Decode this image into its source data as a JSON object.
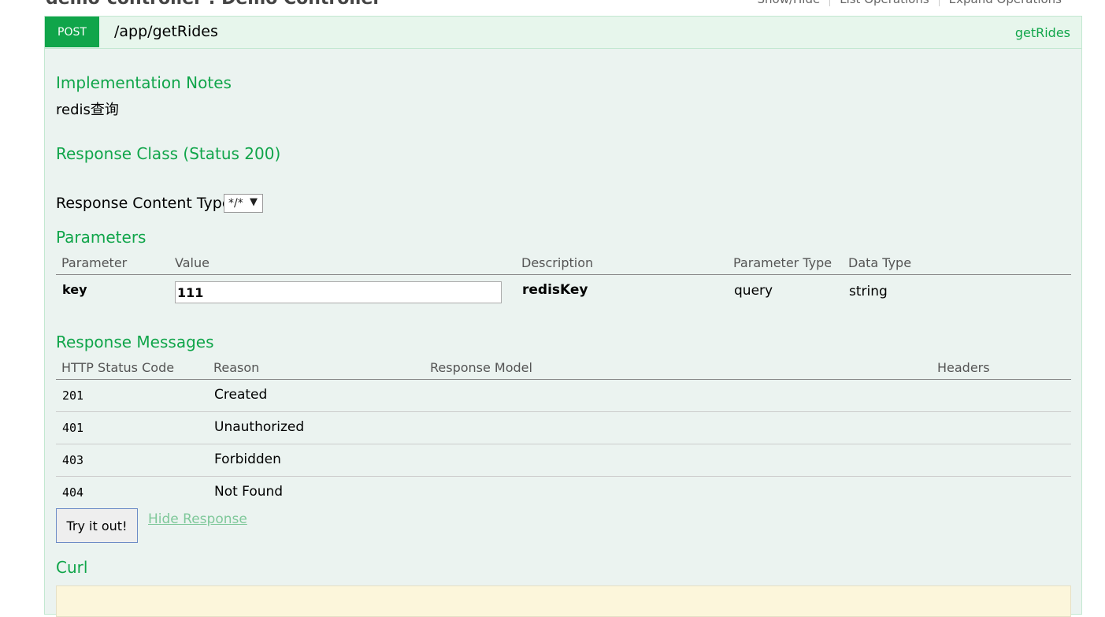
{
  "controller": {
    "title": "demo-controller : Demo Controller",
    "ops": [
      "Show/Hide",
      "List Operations",
      "Expand Operations"
    ]
  },
  "operation": {
    "method": "POST",
    "path": "/app/getRides",
    "name": "getRides",
    "implementation_notes_heading": "Implementation Notes",
    "implementation_notes": "redis查询",
    "response_class_heading": "Response Class (Status 200)",
    "response_content_type_label": "Response Content Type",
    "response_content_type_value": "*/*",
    "parameters_heading": "Parameters",
    "parameter_columns": [
      "Parameter",
      "Value",
      "Description",
      "Parameter Type",
      "Data Type"
    ],
    "parameters": [
      {
        "name": "key",
        "value": "111",
        "description": "redisKey",
        "param_type": "query",
        "data_type": "string"
      }
    ],
    "response_messages_heading": "Response Messages",
    "response_columns": [
      "HTTP Status Code",
      "Reason",
      "Response Model",
      "Headers"
    ],
    "responses": [
      {
        "code": "201",
        "reason": "Created"
      },
      {
        "code": "401",
        "reason": "Unauthorized"
      },
      {
        "code": "403",
        "reason": "Forbidden"
      },
      {
        "code": "404",
        "reason": "Not Found"
      }
    ],
    "try_button": "Try it out!",
    "hide_response": "Hide Response",
    "curl_heading": "Curl"
  },
  "colors": {
    "accent": "#10a54a",
    "panel_bg": "#ebf3f0",
    "heading_bg": "#e7f6ec",
    "curl_bg": "#fcf6db"
  }
}
